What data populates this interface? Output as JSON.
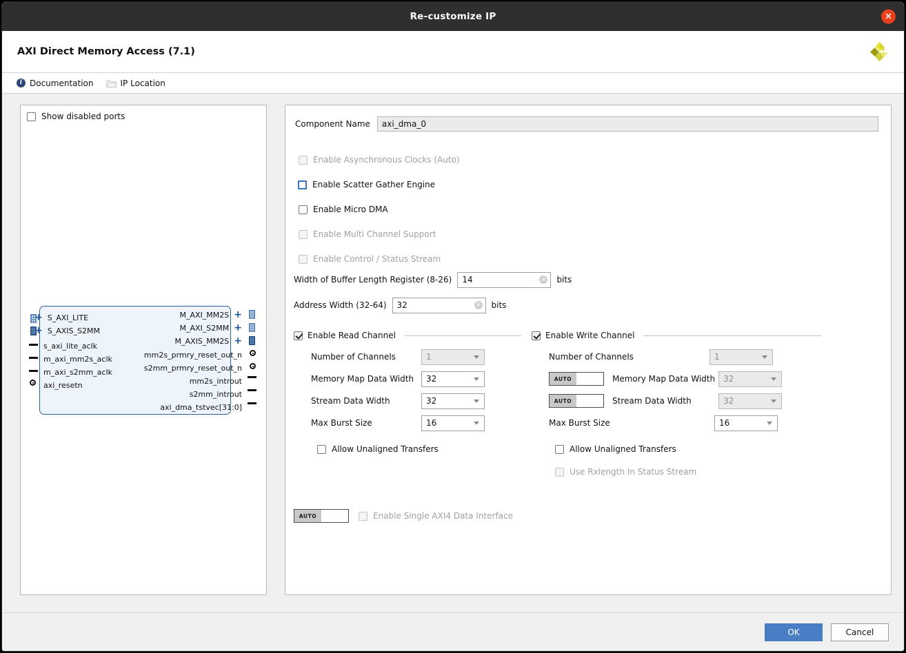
{
  "window": {
    "title": "Re-customize IP",
    "close_label": "×"
  },
  "header": {
    "title": "AXI Direct Memory Access (7.1)",
    "logo_name": "xilinx-logo"
  },
  "toolbar": {
    "documentation_label": "Documentation",
    "ip_location_label": "IP Location"
  },
  "left_panel": {
    "show_disabled_ports_label": "Show disabled ports",
    "show_disabled_ports_checked": false,
    "diagram": {
      "left_ports": [
        {
          "label": "S_AXI_LITE",
          "type": "bus"
        },
        {
          "label": "S_AXIS_S2MM",
          "type": "bus-dense"
        },
        {
          "label": "s_axi_lite_aclk",
          "type": "pin"
        },
        {
          "label": "m_axi_mm2s_aclk",
          "type": "pin"
        },
        {
          "label": "m_axi_s2mm_aclk",
          "type": "pin"
        },
        {
          "label": "axi_resetn",
          "type": "pin-circle"
        }
      ],
      "right_ports": [
        {
          "label": "M_AXI_MM2S",
          "type": "bus"
        },
        {
          "label": "M_AXI_S2MM",
          "type": "bus"
        },
        {
          "label": "M_AXIS_MM2S",
          "type": "bus-dense"
        },
        {
          "label": "mm2s_prmry_reset_out_n",
          "type": "pin-circle"
        },
        {
          "label": "s2mm_prmry_reset_out_n",
          "type": "pin-circle"
        },
        {
          "label": "mm2s_introut",
          "type": "pin"
        },
        {
          "label": "s2mm_introut",
          "type": "pin"
        },
        {
          "label": "axi_dma_tstvec[31:0]",
          "type": "pin"
        }
      ]
    }
  },
  "main": {
    "component_name_label": "Component Name",
    "component_name_value": "axi_dma_0",
    "options": [
      {
        "label": "Enable Asynchronous Clocks (Auto)",
        "checked": false,
        "disabled": true,
        "focused": false
      },
      {
        "label": "Enable Scatter Gather Engine",
        "checked": false,
        "disabled": false,
        "focused": true
      },
      {
        "label": "Enable Micro DMA",
        "checked": false,
        "disabled": false,
        "focused": false
      },
      {
        "label": "Enable Multi Channel Support",
        "checked": false,
        "disabled": true,
        "focused": false
      },
      {
        "label": "Enable Control / Status Stream",
        "checked": false,
        "disabled": true,
        "focused": false
      }
    ],
    "buffer_length": {
      "label": "Width of Buffer Length Register (8-26)",
      "value": "14",
      "units": "bits",
      "clear_icon": "×"
    },
    "address_width": {
      "label": "Address Width (32-64)",
      "value": "32",
      "units": "bits",
      "clear_icon": "×"
    },
    "read_channel": {
      "title": "Enable Read Channel",
      "checked": true,
      "rows": [
        {
          "label": "Number of Channels",
          "value": "1",
          "disabled": true,
          "auto": false
        },
        {
          "label": "Memory Map Data Width",
          "value": "32",
          "disabled": false,
          "auto": false
        },
        {
          "label": "Stream Data Width",
          "value": "32",
          "disabled": false,
          "auto": false
        },
        {
          "label": "Max Burst Size",
          "value": "16",
          "disabled": false,
          "auto": false
        }
      ],
      "allow_unaligned_label": "Allow Unaligned Transfers",
      "allow_unaligned_checked": false
    },
    "write_channel": {
      "title": "Enable Write Channel",
      "checked": true,
      "rows": [
        {
          "label": "Number of Channels",
          "value": "1",
          "disabled": true,
          "auto": false
        },
        {
          "label": "Memory Map Data Width",
          "value": "32",
          "disabled": true,
          "auto": true
        },
        {
          "label": "Stream Data Width",
          "value": "32",
          "disabled": true,
          "auto": true
        },
        {
          "label": "Max Burst Size",
          "value": "16",
          "disabled": false,
          "auto": false
        }
      ],
      "allow_unaligned_label": "Allow Unaligned Transfers",
      "allow_unaligned_checked": false,
      "use_rxlength_label": "Use Rxlength In Status Stream",
      "use_rxlength_checked": false,
      "use_rxlength_disabled": true
    },
    "single_axi4": {
      "auto_label": "AUTO",
      "label": "Enable Single AXI4 Data Interface",
      "checked": false,
      "disabled": true
    },
    "auto_button_label": "AUTO"
  },
  "footer": {
    "ok_label": "OK",
    "cancel_label": "Cancel"
  }
}
